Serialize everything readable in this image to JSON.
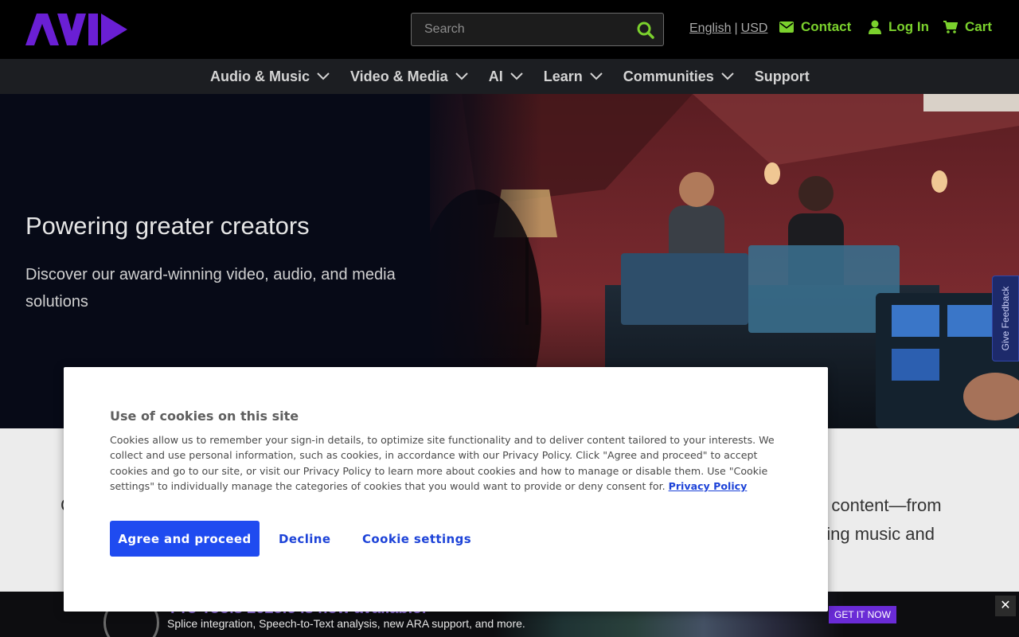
{
  "header": {
    "brand_color": "#6a1fd4",
    "search": {
      "placeholder": "Search",
      "icon": "search-icon"
    },
    "language": "English",
    "separator": "|",
    "currency": "USD",
    "contact_label": "Contact",
    "login_label": "Log In",
    "cart_label": "Cart",
    "accent_color": "#7bd12d"
  },
  "nav": {
    "items": [
      {
        "label": "Audio & Music"
      },
      {
        "label": "Video & Media"
      },
      {
        "label": "AI"
      },
      {
        "label": "Learn"
      },
      {
        "label": "Communities"
      },
      {
        "label": "Support"
      }
    ]
  },
  "hero": {
    "title": "Powering greater creators",
    "subtitle": "Discover our award-winning video, audio, and media solutions"
  },
  "feedback": {
    "label": "Give Feedback"
  },
  "section2": {
    "left_fragment": "C",
    "right_fragment_1": "o content—from",
    "right_fragment_2": "ping music and"
  },
  "promo": {
    "title": "Pro Tools 2025.6 is now available!",
    "subtitle": "Splice integration, Speech-to-Text analysis, new ARA support, and more.",
    "cta": "GET IT NOW",
    "close": "✕"
  },
  "cookie": {
    "title": "Use of cookies on this site",
    "body": "Cookies allow us to remember your sign-in details, to optimize site functionality and to deliver content tailored to your interests. We collect and use personal information, such as cookies, in accordance with our Privacy Policy. Click \"Agree and proceed\" to accept cookies and go to our site, or visit our Privacy Policy to learn more about cookies and how to manage or disable them. Use \"Cookie settings\" to individually manage the categories of cookies that you would want to provide or deny consent for.",
    "policy_link": "Privacy Policy",
    "agree_label": "Agree and proceed",
    "decline_label": "Decline",
    "settings_label": "Cookie settings",
    "button_color": "#1f4bf0"
  }
}
